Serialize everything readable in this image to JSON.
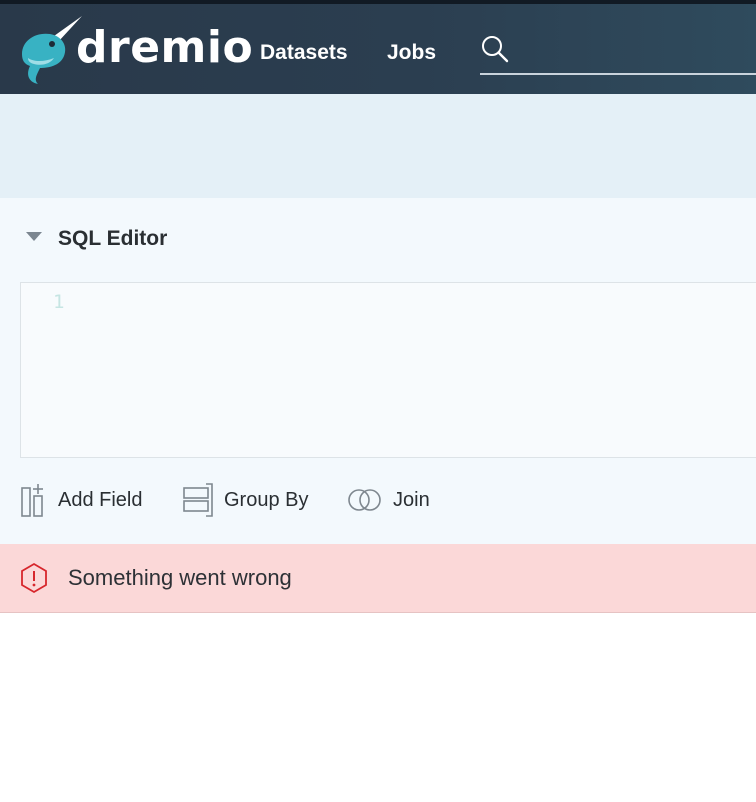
{
  "header": {
    "logo_text": "dremio",
    "nav": {
      "datasets": "Datasets",
      "jobs": "Jobs"
    },
    "search": {
      "placeholder": ""
    },
    "colors": {
      "bar": "#2b3e50",
      "logo_teal": "#38b2c3"
    }
  },
  "sql_editor": {
    "title": "SQL Editor",
    "line_numbers": [
      "1"
    ]
  },
  "toolbar": {
    "add_field": "Add Field",
    "group_by": "Group By",
    "join": "Join"
  },
  "error": {
    "message": "Something went wrong",
    "colors": {
      "background": "#fbd8d8",
      "icon": "#d7262c"
    }
  }
}
